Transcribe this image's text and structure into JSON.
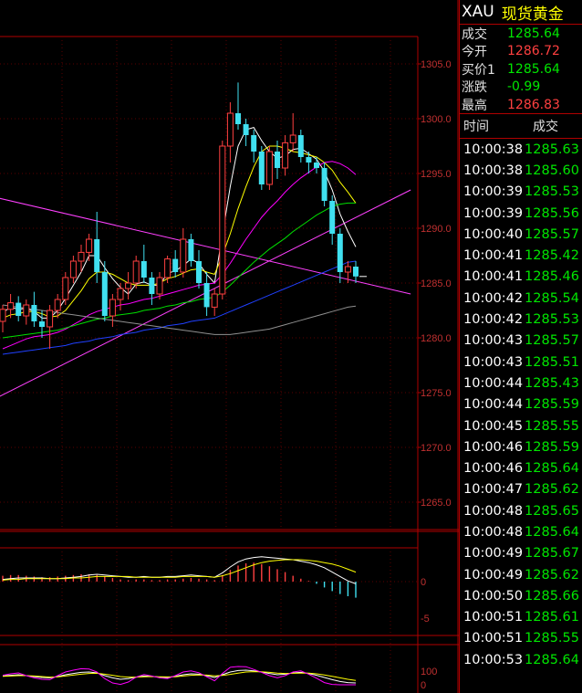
{
  "symbol": {
    "code": "XAU",
    "name": "现货黄金"
  },
  "quote": [
    {
      "label": "成交",
      "value": "1285.64",
      "color": "#00e600"
    },
    {
      "label": "今开",
      "value": "1286.72",
      "color": "#ff4040"
    },
    {
      "label": "买价1",
      "value": "1285.64",
      "color": "#00e600"
    },
    {
      "label": "涨跌",
      "value": "-0.99",
      "color": "#00e600"
    },
    {
      "label": "最高",
      "value": "1286.83",
      "color": "#ff4040"
    }
  ],
  "ticks_header": {
    "time": "时间",
    "price": "成交"
  },
  "ticks": [
    {
      "time": "10:00:38",
      "price": "1285.63"
    },
    {
      "time": "10:00:38",
      "price": "1285.60"
    },
    {
      "time": "10:00:39",
      "price": "1285.53"
    },
    {
      "time": "10:00:39",
      "price": "1285.56"
    },
    {
      "time": "10:00:40",
      "price": "1285.57"
    },
    {
      "time": "10:00:41",
      "price": "1285.42"
    },
    {
      "time": "10:00:41",
      "price": "1285.46"
    },
    {
      "time": "10:00:42",
      "price": "1285.54"
    },
    {
      "time": "10:00:42",
      "price": "1285.53"
    },
    {
      "time": "10:00:43",
      "price": "1285.57"
    },
    {
      "time": "10:00:43",
      "price": "1285.51"
    },
    {
      "time": "10:00:44",
      "price": "1285.43"
    },
    {
      "time": "10:00:44",
      "price": "1285.59"
    },
    {
      "time": "10:00:45",
      "price": "1285.55"
    },
    {
      "time": "10:00:46",
      "price": "1285.59"
    },
    {
      "time": "10:00:46",
      "price": "1285.64"
    },
    {
      "time": "10:00:47",
      "price": "1285.62"
    },
    {
      "time": "10:00:48",
      "price": "1285.65"
    },
    {
      "time": "10:00:48",
      "price": "1285.64"
    },
    {
      "time": "10:00:49",
      "price": "1285.67"
    },
    {
      "time": "10:00:49",
      "price": "1285.62"
    },
    {
      "time": "10:00:50",
      "price": "1285.66"
    },
    {
      "time": "10:00:51",
      "price": "1285.61"
    },
    {
      "time": "10:00:51",
      "price": "1285.55"
    },
    {
      "time": "10:00:53",
      "price": "1285.64"
    }
  ],
  "chart_data": [
    {
      "type": "candlestick",
      "panel": "main",
      "ylim": [
        1262.5,
        1307.5
      ],
      "yticks": [
        1265.0,
        1270.0,
        1275.0,
        1280.0,
        1285.0,
        1290.0,
        1295.0,
        1300.0,
        1305.0
      ],
      "annotation": {
        "label": "1303.33",
        "value": 1303.33
      },
      "colors": {
        "up": "#ff4040",
        "down": "#40e0f0"
      },
      "candles": [
        [
          1281.5,
          1283.0,
          1280.5,
          1282.6
        ],
        [
          1282.6,
          1284.0,
          1281.8,
          1283.2
        ],
        [
          1283.2,
          1283.8,
          1281.5,
          1282.0
        ],
        [
          1282.0,
          1283.5,
          1281.2,
          1283.0
        ],
        [
          1283.0,
          1284.2,
          1281.0,
          1281.5
        ],
        [
          1281.5,
          1282.5,
          1280.0,
          1281.0
        ],
        [
          1281.0,
          1283.0,
          1279.0,
          1282.5
        ],
        [
          1282.5,
          1284.0,
          1281.8,
          1283.5
        ],
        [
          1283.5,
          1286.0,
          1283.0,
          1285.5
        ],
        [
          1285.5,
          1287.5,
          1285.0,
          1287.0
        ],
        [
          1287.0,
          1288.5,
          1286.0,
          1287.8
        ],
        [
          1287.8,
          1289.5,
          1287.0,
          1289.0
        ],
        [
          1289.0,
          1291.5,
          1285.0,
          1286.0
        ],
        [
          1286.0,
          1287.0,
          1281.5,
          1282.0
        ],
        [
          1282.0,
          1284.0,
          1281.0,
          1283.5
        ],
        [
          1283.5,
          1285.0,
          1282.5,
          1284.5
        ],
        [
          1284.5,
          1286.0,
          1283.5,
          1285.0
        ],
        [
          1285.0,
          1287.5,
          1284.5,
          1287.0
        ],
        [
          1287.0,
          1288.5,
          1285.0,
          1285.5
        ],
        [
          1285.5,
          1286.0,
          1283.0,
          1284.0
        ],
        [
          1284.0,
          1286.0,
          1283.5,
          1285.5
        ],
        [
          1285.5,
          1287.5,
          1285.0,
          1287.2
        ],
        [
          1287.2,
          1288.0,
          1285.5,
          1286.0
        ],
        [
          1286.0,
          1290.0,
          1285.5,
          1289.0
        ],
        [
          1289.0,
          1289.5,
          1286.5,
          1287.0
        ],
        [
          1287.0,
          1288.0,
          1284.5,
          1285.0
        ],
        [
          1285.0,
          1286.0,
          1282.0,
          1282.8
        ],
        [
          1282.8,
          1284.5,
          1282.0,
          1284.0
        ],
        [
          1284.0,
          1298.0,
          1283.5,
          1297.5
        ],
        [
          1297.5,
          1301.5,
          1296.0,
          1300.5
        ],
        [
          1300.5,
          1303.3,
          1299.0,
          1299.5
        ],
        [
          1299.5,
          1300.0,
          1297.5,
          1298.5
        ],
        [
          1298.5,
          1299.0,
          1296.0,
          1297.0
        ],
        [
          1297.0,
          1297.5,
          1293.5,
          1294.0
        ],
        [
          1294.0,
          1297.5,
          1293.5,
          1297.0
        ],
        [
          1297.0,
          1298.0,
          1294.5,
          1295.5
        ],
        [
          1295.5,
          1298.5,
          1294.8,
          1297.8
        ],
        [
          1297.8,
          1300.5,
          1297.0,
          1298.5
        ],
        [
          1298.5,
          1299.0,
          1296.0,
          1296.5
        ],
        [
          1296.5,
          1297.0,
          1295.0,
          1296.0
        ],
        [
          1296.0,
          1296.5,
          1295.0,
          1295.5
        ],
        [
          1295.5,
          1296.0,
          1292.0,
          1292.5
        ],
        [
          1292.5,
          1293.0,
          1288.5,
          1289.5
        ],
        [
          1289.5,
          1290.0,
          1285.0,
          1286.0
        ],
        [
          1286.0,
          1287.0,
          1285.0,
          1286.5
        ],
        [
          1286.5,
          1287.0,
          1285.0,
          1285.6
        ]
      ],
      "x_count": 55,
      "trendlines": [
        {
          "from": [
            -5,
            1293.5
          ],
          "to": [
            52,
            1284.0
          ],
          "color": "#ff40ff"
        },
        {
          "from": [
            -5,
            1273.0
          ],
          "to": [
            52,
            1293.5
          ],
          "color": "#ff40ff"
        }
      ],
      "moving_averages": [
        {
          "color": "#ffffff",
          "values": [
            1282.3,
            1282.8,
            1282.6,
            1282.7,
            1282.4,
            1281.8,
            1281.8,
            1282.5,
            1283.6,
            1284.8,
            1286.0,
            1287.5,
            1287.5,
            1286.4,
            1285.4,
            1284.6,
            1284.0,
            1284.9,
            1285.1,
            1284.8,
            1284.8,
            1285.9,
            1286.1,
            1286.6,
            1287.2,
            1286.8,
            1285.8,
            1285.0,
            1289.4,
            1293.8,
            1297.5,
            1299.0,
            1299.2,
            1298.0,
            1297.0,
            1296.4,
            1296.6,
            1297.2,
            1297.3,
            1296.8,
            1296.3,
            1295.2,
            1293.5,
            1291.3,
            1289.7,
            1288.3
          ]
        },
        {
          "color": "#ffff00",
          "values": [
            1281.8,
            1282.1,
            1282.2,
            1282.4,
            1282.4,
            1282.2,
            1281.9,
            1282.0,
            1282.5,
            1283.4,
            1284.3,
            1285.4,
            1286.0,
            1286.0,
            1285.8,
            1285.4,
            1285.0,
            1284.8,
            1284.8,
            1284.8,
            1285.0,
            1285.4,
            1285.6,
            1285.9,
            1286.2,
            1286.3,
            1286.0,
            1285.8,
            1287.5,
            1289.5,
            1291.8,
            1293.8,
            1295.6,
            1297.0,
            1297.5,
            1297.5,
            1297.3,
            1297.0,
            1296.9,
            1296.7,
            1296.5,
            1296.0,
            1295.3,
            1294.2,
            1293.3,
            1292.3
          ]
        },
        {
          "color": "#ff00ff",
          "values": [
            1279.0,
            1279.3,
            1279.6,
            1279.9,
            1280.1,
            1280.2,
            1280.3,
            1280.5,
            1280.8,
            1281.2,
            1281.6,
            1282.1,
            1282.4,
            1282.6,
            1282.8,
            1283.0,
            1283.1,
            1283.3,
            1283.5,
            1283.6,
            1283.8,
            1284.0,
            1284.2,
            1284.4,
            1284.6,
            1284.8,
            1284.9,
            1285.0,
            1285.8,
            1286.8,
            1287.9,
            1289.0,
            1290.0,
            1291.0,
            1291.8,
            1292.5,
            1293.3,
            1294.0,
            1294.6,
            1295.1,
            1295.6,
            1296.0,
            1296.1,
            1295.9,
            1295.5,
            1294.9
          ]
        },
        {
          "color": "#00e000",
          "values": [
            1280.0,
            1280.1,
            1280.2,
            1280.3,
            1280.4,
            1280.5,
            1280.6,
            1280.7,
            1280.9,
            1281.1,
            1281.3,
            1281.5,
            1281.7,
            1281.8,
            1282.0,
            1282.1,
            1282.2,
            1282.3,
            1282.5,
            1282.6,
            1282.7,
            1282.9,
            1283.0,
            1283.2,
            1283.3,
            1283.5,
            1283.6,
            1283.7,
            1284.2,
            1284.8,
            1285.5,
            1286.2,
            1286.9,
            1287.5,
            1288.1,
            1288.6,
            1289.1,
            1289.7,
            1290.2,
            1290.7,
            1291.2,
            1291.6,
            1292.0,
            1292.2,
            1292.3,
            1292.3
          ]
        },
        {
          "color": "#2040ff",
          "values": [
            1278.5,
            1278.6,
            1278.7,
            1278.8,
            1278.9,
            1279.0,
            1279.1,
            1279.2,
            1279.3,
            1279.5,
            1279.6,
            1279.7,
            1279.9,
            1280.0,
            1280.1,
            1280.3,
            1280.4,
            1280.5,
            1280.7,
            1280.8,
            1280.9,
            1281.1,
            1281.2,
            1281.3,
            1281.5,
            1281.6,
            1281.7,
            1281.8,
            1282.1,
            1282.4,
            1282.7,
            1283.0,
            1283.3,
            1283.6,
            1283.9,
            1284.2,
            1284.5,
            1284.8,
            1285.1,
            1285.4,
            1285.7,
            1286.0,
            1286.3,
            1286.6,
            1286.9,
            1287.0
          ]
        },
        {
          "color": "#909090",
          "values": [
            1283.0,
            1282.9,
            1282.8,
            1282.7,
            1282.6,
            1282.5,
            1282.4,
            1282.3,
            1282.2,
            1282.1,
            1282.0,
            1281.9,
            1281.8,
            1281.7,
            1281.6,
            1281.5,
            1281.4,
            1281.3,
            1281.2,
            1281.1,
            1281.0,
            1280.9,
            1280.8,
            1280.7,
            1280.6,
            1280.5,
            1280.4,
            1280.3,
            1280.3,
            1280.3,
            1280.4,
            1280.5,
            1280.6,
            1280.7,
            1280.8,
            1281.0,
            1281.2,
            1281.4,
            1281.6,
            1281.8,
            1282.0,
            1282.2,
            1282.4,
            1282.6,
            1282.8,
            1282.9
          ]
        }
      ]
    },
    {
      "type": "bar",
      "panel": "macd",
      "ylim": [
        -5,
        5
      ],
      "yticks": [
        0,
        -5
      ],
      "histogram": [
        0.8,
        0.9,
        0.9,
        0.8,
        0.7,
        0.6,
        0.6,
        0.7,
        0.8,
        0.9,
        1.0,
        1.0,
        0.9,
        0.7,
        0.5,
        0.3,
        0.2,
        0.3,
        0.3,
        0.2,
        0.2,
        0.3,
        0.3,
        0.4,
        0.5,
        0.4,
        0.3,
        0.2,
        0.9,
        1.6,
        2.2,
        2.5,
        2.6,
        2.4,
        2.1,
        1.7,
        1.3,
        0.8,
        0.4,
        0.1,
        -0.3,
        -0.8,
        -1.3,
        -1.7,
        -2.0,
        -2.2
      ],
      "lines": [
        {
          "color": "#ffffff",
          "values": [
            0.3,
            0.4,
            0.5,
            0.5,
            0.5,
            0.5,
            0.4,
            0.4,
            0.5,
            0.6,
            0.7,
            0.9,
            1.0,
            0.9,
            0.8,
            0.7,
            0.6,
            0.6,
            0.7,
            0.6,
            0.6,
            0.7,
            0.7,
            0.8,
            0.9,
            0.8,
            0.7,
            0.6,
            1.2,
            2.0,
            2.7,
            3.1,
            3.3,
            3.4,
            3.3,
            3.2,
            3.1,
            3.0,
            2.8,
            2.6,
            2.3,
            1.9,
            1.3,
            0.7,
            0.1,
            -0.3
          ]
        },
        {
          "color": "#ffff00",
          "values": [
            0.2,
            0.3,
            0.3,
            0.4,
            0.4,
            0.4,
            0.4,
            0.4,
            0.4,
            0.5,
            0.5,
            0.6,
            0.7,
            0.7,
            0.7,
            0.7,
            0.7,
            0.6,
            0.6,
            0.6,
            0.6,
            0.6,
            0.6,
            0.7,
            0.7,
            0.7,
            0.7,
            0.6,
            0.8,
            1.1,
            1.5,
            1.9,
            2.3,
            2.6,
            2.8,
            2.9,
            3.0,
            3.0,
            3.0,
            2.9,
            2.8,
            2.6,
            2.4,
            2.1,
            1.7,
            1.3
          ]
        }
      ]
    },
    {
      "type": "line",
      "panel": "kdj",
      "ylim": [
        0,
        100
      ],
      "yticks": [
        100,
        50,
        0
      ],
      "series": [
        {
          "color": "#ffffff",
          "values": [
            48,
            52,
            55,
            50,
            45,
            40,
            38,
            45,
            55,
            62,
            68,
            70,
            65,
            50,
            38,
            30,
            34,
            42,
            48,
            46,
            42,
            40,
            46,
            55,
            60,
            58,
            50,
            40,
            55,
            70,
            78,
            80,
            76,
            70,
            62,
            55,
            58,
            65,
            68,
            62,
            52,
            40,
            28,
            18,
            12,
            10
          ]
        },
        {
          "color": "#ffff00",
          "values": [
            46,
            48,
            50,
            50,
            48,
            45,
            42,
            43,
            48,
            53,
            58,
            62,
            63,
            58,
            52,
            45,
            42,
            42,
            44,
            45,
            44,
            43,
            44,
            48,
            52,
            54,
            53,
            49,
            51,
            57,
            64,
            70,
            72,
            71,
            68,
            64,
            62,
            63,
            64,
            64,
            60,
            54,
            46,
            38,
            30,
            24
          ]
        },
        {
          "color": "#ff00ff",
          "values": [
            52,
            60,
            65,
            50,
            38,
            30,
            28,
            50,
            70,
            80,
            88,
            86,
            70,
            34,
            10,
            2,
            15,
            42,
            56,
            48,
            38,
            34,
            50,
            70,
            76,
            66,
            44,
            22,
            62,
            96,
            100,
            99,
            84,
            68,
            50,
            38,
            50,
            70,
            76,
            58,
            36,
            12,
            2,
            0,
            0,
            0
          ]
        }
      ]
    }
  ]
}
